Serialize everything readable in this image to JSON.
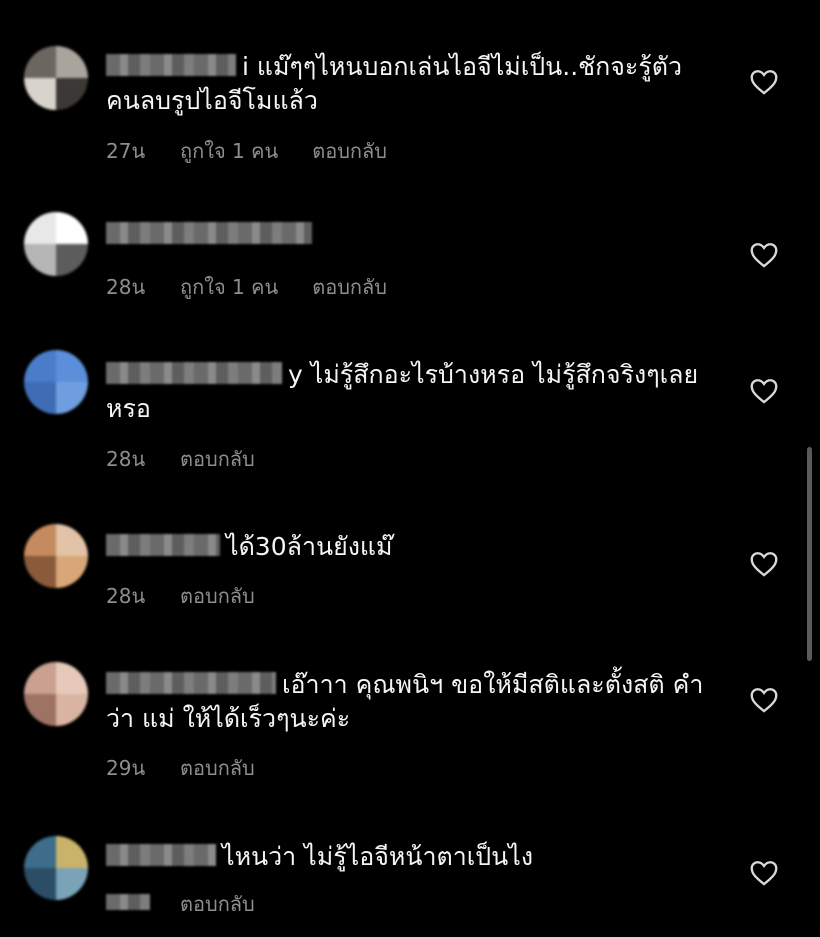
{
  "comments": [
    {
      "text": "i แม๊ๆๆไหนบอกเล่นไอจีไม่เป็น..ชักจะรู้ตัว คนลบรูปไอจีโมแล้ว",
      "time": "27น",
      "likes": "ถูกใจ 1 คน",
      "reply": "ตอบกลับ",
      "avatar_colors": [
        "#6b6660",
        "#a9a49c",
        "#d8d4cc",
        "#3b3835"
      ]
    },
    {
      "text": "",
      "time": "28น",
      "likes": "ถูกใจ 1 คน",
      "reply": "ตอบกลับ",
      "avatar_colors": [
        "#e8e8e8",
        "#ffffff",
        "#b5b5b5",
        "#5c5c5c"
      ]
    },
    {
      "text": "y ไม่รู้สึกอะไรบ้างหรอ ไม่รู้สึกจริงๆเลย หรอ",
      "time": "28น",
      "likes": "",
      "reply": "ตอบกลับ",
      "avatar_colors": [
        "#4a7dc9",
        "#5b8fda",
        "#3f6db5",
        "#6f9fe0"
      ]
    },
    {
      "text": "ได้30ล้านยังแม๊",
      "time": "28น",
      "likes": "",
      "reply": "ตอบกลับ",
      "avatar_colors": [
        "#c58a5e",
        "#e2c3a8",
        "#8a5a3a",
        "#d9a777"
      ]
    },
    {
      "text": "เอ๊าาา คุณพนิฯ ขอให้มีสติและตั้งสติ คําว่า แม่ ให้ได้เร็วๆนะค่ะ",
      "time": "29น",
      "likes": "",
      "reply": "ตอบกลับ",
      "avatar_colors": [
        "#caa090",
        "#e6c9bb",
        "#9e7364",
        "#d9b4a3"
      ]
    },
    {
      "text": "ไหนว่า ไม่รู้ไอจีหน้าตาเป็นไง",
      "time": "",
      "likes": "",
      "reply": "ตอบกลับ",
      "avatar_colors": [
        "#3d6d8a",
        "#c9b36a",
        "#2b4d66",
        "#7aa3b8"
      ]
    }
  ],
  "colors": {
    "background": "#000000",
    "text": "#f5f5f5",
    "meta": "#8e8e8e",
    "scrollbar": "#5a5a5a"
  },
  "icons": {
    "like": "heart-outline-icon"
  }
}
